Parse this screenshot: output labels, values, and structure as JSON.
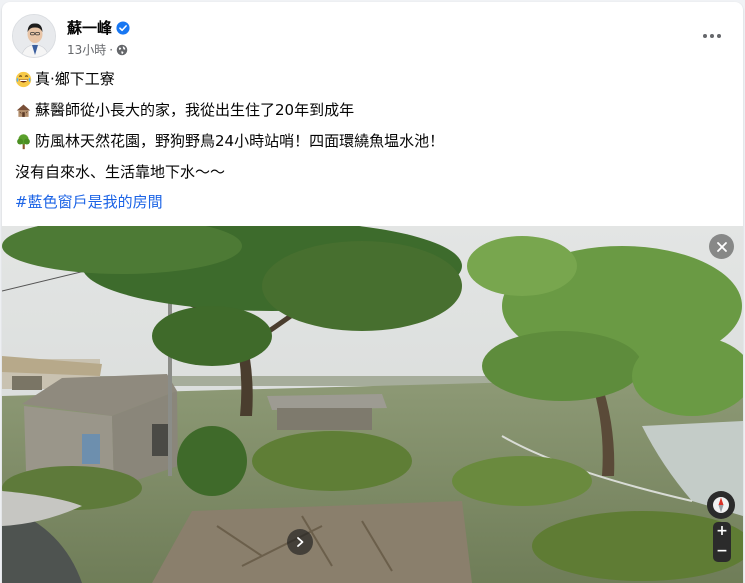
{
  "post": {
    "author": "蘇一峰",
    "time": "13小時",
    "time_separator": "·",
    "privacy_icon": "globe-icon",
    "verified_icon": "verified-badge-icon",
    "more_icon": "more-options-icon"
  },
  "content": {
    "lines": [
      {
        "emoji": "laughing-crying-emoji",
        "text": "真·鄉下工寮"
      },
      {
        "emoji": "derelict-house-emoji",
        "text": "蘇醫師從小長大的家，我從出生住了20年到成年"
      },
      {
        "emoji": "tree-emoji",
        "text": "防風林天然花園，野狗野鳥24小時站哨！四面環繞魚塭水池！"
      },
      {
        "emoji": "",
        "text": "沒有自來水、生活靠地下水～～"
      }
    ],
    "hashtag": "#藍色窗戶是我的房間"
  },
  "photo": {
    "description_icon": "street-view-photo",
    "close_icon": "close-icon",
    "next_icon": "chevron-right-icon",
    "compass_icon": "compass-icon",
    "zoom_in": "+",
    "zoom_out": "−"
  },
  "colors": {
    "hashtag": "#1c64e6",
    "verified": "#1877f2",
    "meta_text": "#65676b"
  }
}
